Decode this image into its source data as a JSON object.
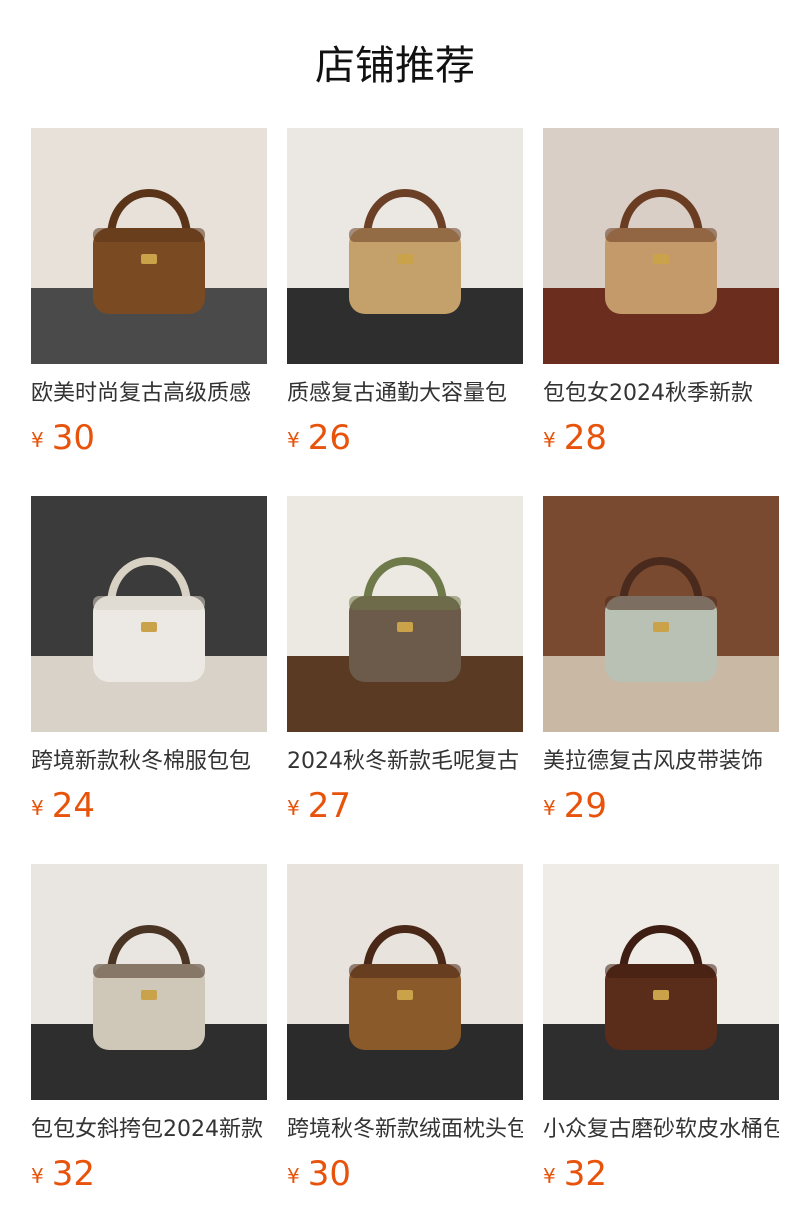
{
  "section": {
    "title": "店铺推荐"
  },
  "currency_symbol": "¥",
  "products": [
    {
      "name": "欧美时尚复古高级质感",
      "price": "30",
      "icon": "brown-boston-bag-image",
      "colors": {
        "bg": "#e7e1da",
        "floor": "#4a4a4a",
        "bag": "#7a4a22",
        "strap": "#5a3418"
      }
    },
    {
      "name": "质感复古通勤大容量包",
      "price": "26",
      "icon": "tan-tote-bag-image",
      "colors": {
        "bg": "#ebe7e3",
        "floor": "#2e2e2e",
        "bag": "#c4a06a",
        "strap": "#6b4026"
      }
    },
    {
      "name": "包包女2024秋季新款",
      "price": "28",
      "icon": "fleece-bucket-bag-image",
      "colors": {
        "bg": "#d9cfc6",
        "floor": "#6b2e1e",
        "bag": "#c49a6a",
        "strap": "#6a3c22"
      }
    },
    {
      "name": "跨境新款秋冬棉服包包",
      "price": "24",
      "icon": "white-puffer-bag-image",
      "colors": {
        "bg": "#3b3b3b",
        "floor": "#d8d2c8",
        "bag": "#ece9e4",
        "strap": "#d8d2c4"
      }
    },
    {
      "name": "2024秋冬新款毛呢复古",
      "price": "27",
      "icon": "plaid-shoulder-bag-image",
      "colors": {
        "bg": "#ece8e2",
        "floor": "#5a3a22",
        "bag": "#6c5a4a",
        "strap": "#6f7a4a"
      }
    },
    {
      "name": "美拉德复古风皮带装饰",
      "price": "29",
      "icon": "grey-hobo-bag-image",
      "colors": {
        "bg": "#7a4a30",
        "floor": "#c9b8a4",
        "bag": "#b9c0b4",
        "strap": "#4a2a1c"
      }
    },
    {
      "name": "包包女斜挎包2024新款",
      "price": "32",
      "icon": "houndstooth-bag-image",
      "colors": {
        "bg": "#e9e6e2",
        "floor": "#2e2e2e",
        "bag": "#cfc7b8",
        "strap": "#4a3424"
      }
    },
    {
      "name": "跨境秋冬新款绒面枕头包",
      "price": "30",
      "icon": "suede-pillow-bag-image",
      "colors": {
        "bg": "#e8e3dc",
        "floor": "#2b2b2b",
        "bag": "#8a5a2a",
        "strap": "#4a2818"
      }
    },
    {
      "name": "小众复古磨砂软皮水桶包",
      "price": "32",
      "icon": "suede-bucket-bag-image",
      "colors": {
        "bg": "#efece7",
        "floor": "#2e2e2e",
        "bag": "#5a2c1a",
        "strap": "#3e1e12"
      }
    }
  ]
}
